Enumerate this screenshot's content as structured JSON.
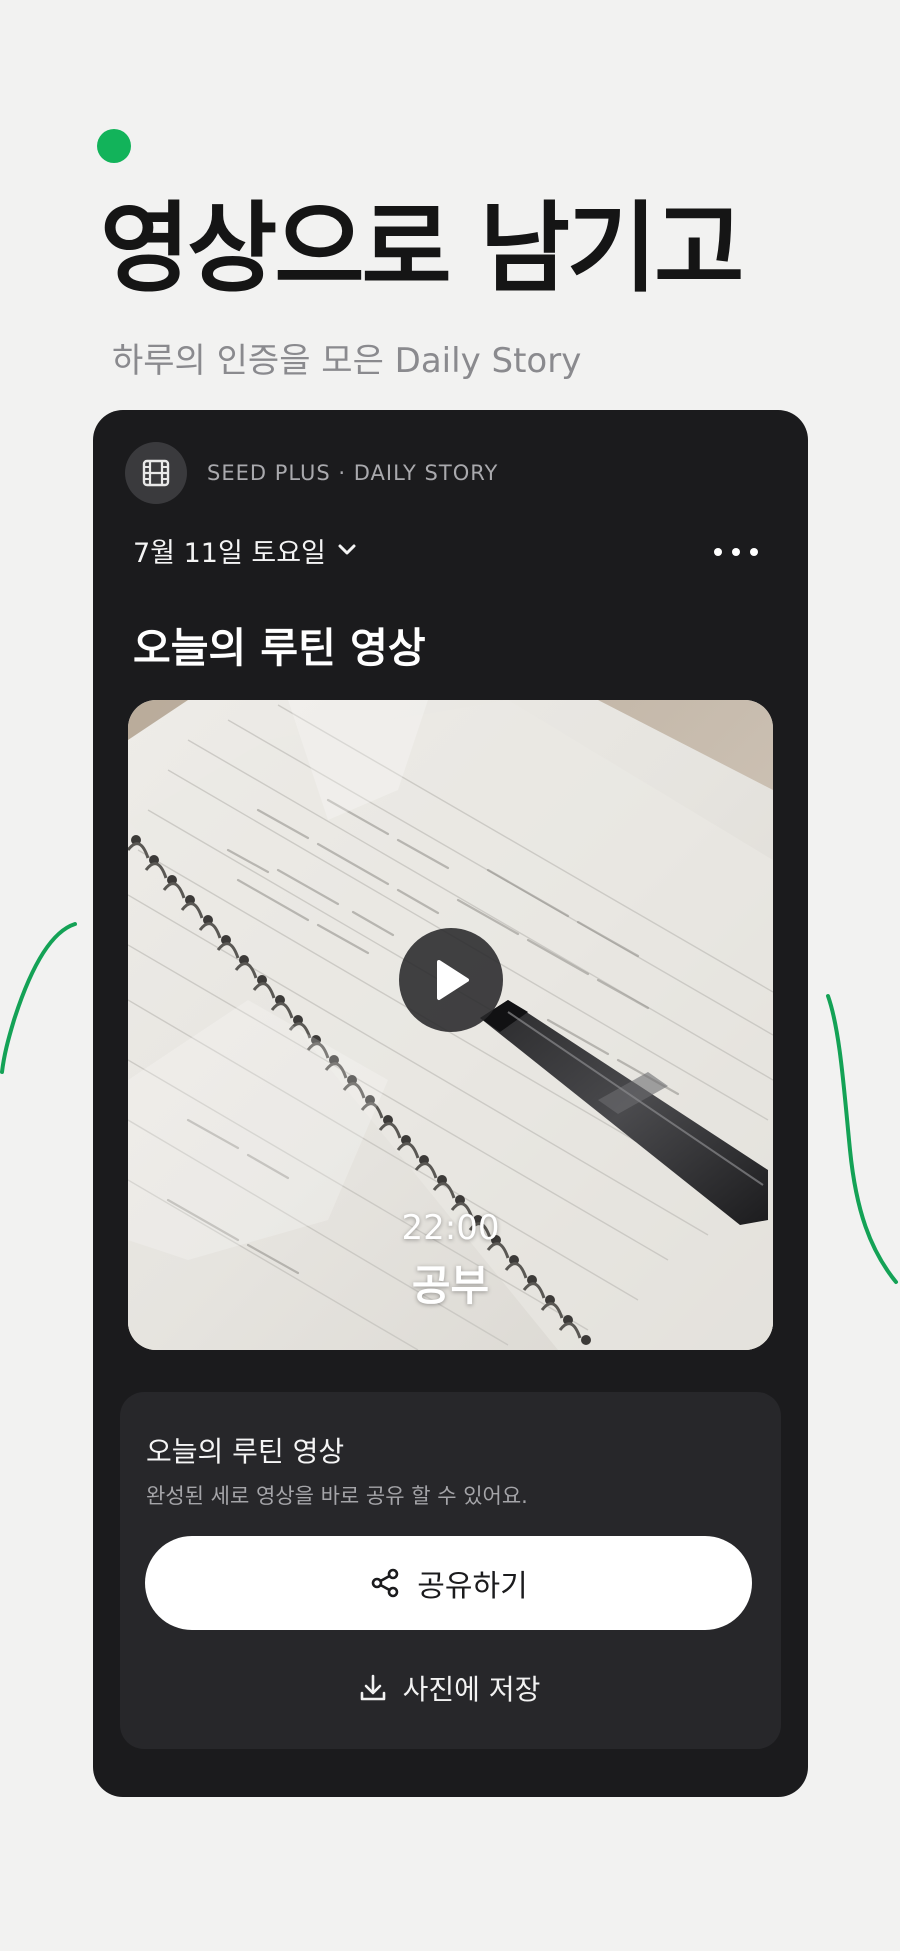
{
  "hero": {
    "title": "영상으로 남기고",
    "subtitle": "하루의 인증을 모은 Daily Story",
    "accent_color": "#12b35a"
  },
  "card": {
    "brand": "SEED PLUS · DAILY STORY",
    "brand_icon": "film-icon",
    "date": "7월 11일 토요일",
    "more_icon": "more-horizontal-icon",
    "title": "오늘의 루틴 영상",
    "video": {
      "time": "22:00",
      "label": "공부",
      "play_icon": "play-icon"
    }
  },
  "share_panel": {
    "title": "오늘의 루틴 영상",
    "description": "완성된 세로 영상을 바로 공유 할 수 있어요.",
    "share_label": "공유하기",
    "share_icon": "share-icon",
    "save_label": "사진에 저장",
    "save_icon": "download-icon"
  }
}
